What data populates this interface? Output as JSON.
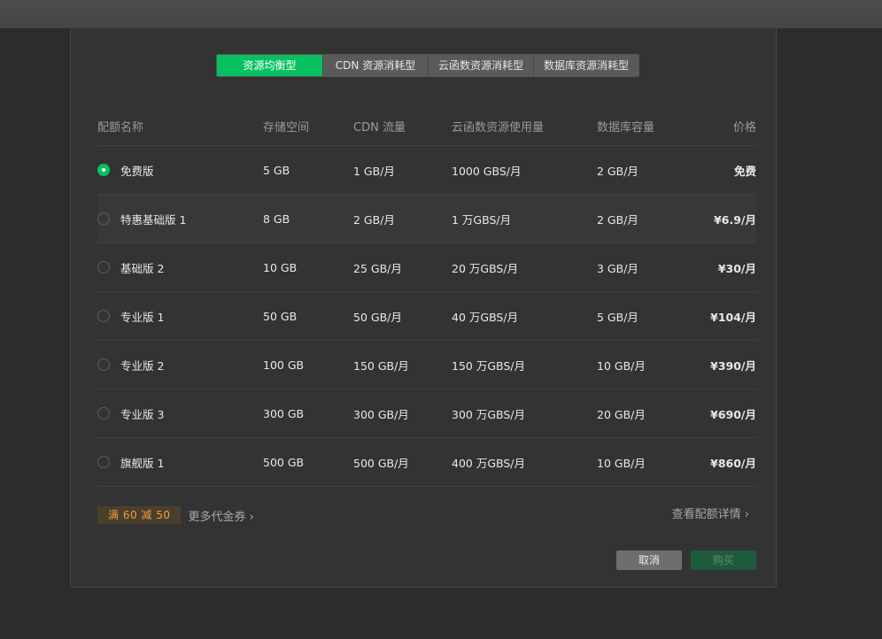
{
  "tabs": [
    {
      "label": "资源均衡型",
      "active": true
    },
    {
      "label": "CDN 资源消耗型",
      "active": false
    },
    {
      "label": "云函数资源消耗型",
      "active": false
    },
    {
      "label": "数据库资源消耗型",
      "active": false
    }
  ],
  "table": {
    "headers": {
      "name": "配额名称",
      "storage": "存储空间",
      "cdn": "CDN 流量",
      "cloud": "云函数资源使用量",
      "db": "数据库容量",
      "price": "价格"
    },
    "rows": [
      {
        "name": "免费版",
        "storage": "5 GB",
        "cdn": "1 GB/月",
        "cloud": "1000 GBS/月",
        "db": "2 GB/月",
        "price": "免费"
      },
      {
        "name": "特惠基础版 1",
        "storage": "8 GB",
        "cdn": "2 GB/月",
        "cloud": "1 万GBS/月",
        "db": "2 GB/月",
        "price": "¥6.9/月"
      },
      {
        "name": "基础版 2",
        "storage": "10 GB",
        "cdn": "25 GB/月",
        "cloud": "20 万GBS/月",
        "db": "3 GB/月",
        "price": "¥30/月"
      },
      {
        "name": "专业版 1",
        "storage": "50 GB",
        "cdn": "50 GB/月",
        "cloud": "40 万GBS/月",
        "db": "5 GB/月",
        "price": "¥104/月"
      },
      {
        "name": "专业版 2",
        "storage": "100 GB",
        "cdn": "150 GB/月",
        "cloud": "150 万GBS/月",
        "db": "10 GB/月",
        "price": "¥390/月"
      },
      {
        "name": "专业版 3",
        "storage": "300 GB",
        "cdn": "300 GB/月",
        "cloud": "300 万GBS/月",
        "db": "20 GB/月",
        "price": "¥690/月"
      },
      {
        "name": "旗舰版 1",
        "storage": "500 GB",
        "cdn": "500 GB/月",
        "cloud": "400 万GBS/月",
        "db": "10 GB/月",
        "price": "¥860/月"
      }
    ]
  },
  "footer": {
    "coupon": "满 60 减 50",
    "more_coupons": "更多代金券 ›",
    "detail_link": "查看配额详情 ›",
    "cancel": "取消",
    "buy": "购买"
  },
  "colors": {
    "accent": "#07c160",
    "coupon_text": "#f0a030"
  },
  "icons": {
    "radio_checked": "radio-checked-icon",
    "radio_unchecked": "radio-unchecked-icon",
    "chevron": "chevron-right-icon"
  }
}
